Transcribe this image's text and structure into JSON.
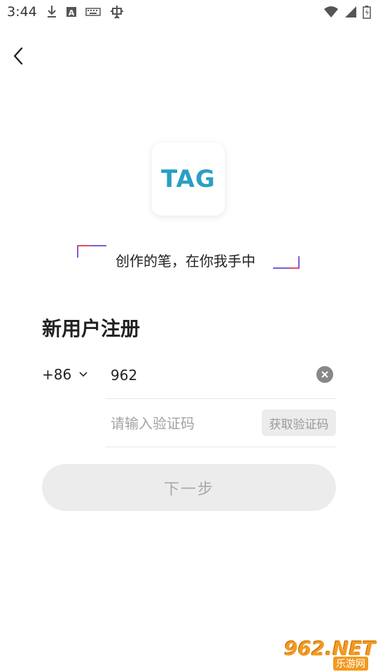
{
  "status_bar": {
    "time": "3:44"
  },
  "logo": {
    "text": "TAG"
  },
  "slogan": "创作的笔，在你我手中",
  "page_title": "新用户注册",
  "phone": {
    "country_code": "+86",
    "value": "962"
  },
  "verification": {
    "placeholder": "请输入验证码",
    "get_code_label": "获取验证码"
  },
  "next_button_label": "下一步",
  "watermark": {
    "main": "962.NET",
    "sub": "乐游网"
  },
  "colors": {
    "logo": "#2a9fc4",
    "bracket_purple": "#7d5bd6",
    "bracket_red": "#e24a6a",
    "disabled_button_bg": "#ececec"
  }
}
